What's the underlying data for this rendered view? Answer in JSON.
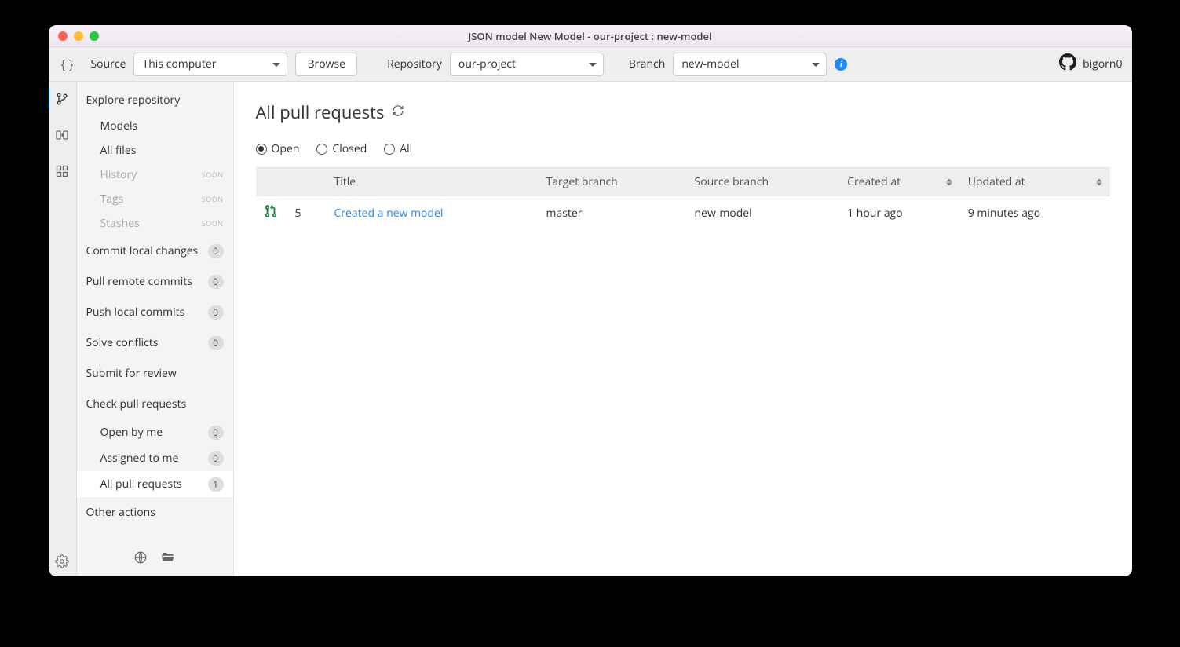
{
  "window": {
    "title": "JSON model New Model - our-project : new-model"
  },
  "toolbar": {
    "source_label": "Source",
    "source_value": "This computer",
    "browse_label": "Browse",
    "repository_label": "Repository",
    "repository_value": "our-project",
    "branch_label": "Branch",
    "branch_value": "new-model",
    "username": "bigorn0"
  },
  "sidebar": {
    "explore_header": "Explore repository",
    "models": "Models",
    "all_files": "All files",
    "history": "History",
    "tags": "Tags",
    "stashes": "Stashes",
    "soon_label": "SOON",
    "commit_local": {
      "label": "Commit local changes",
      "count": "0"
    },
    "pull_remote": {
      "label": "Pull remote commits",
      "count": "0"
    },
    "push_local": {
      "label": "Push local commits",
      "count": "0"
    },
    "solve_conflicts": {
      "label": "Solve conflicts",
      "count": "0"
    },
    "submit_review": "Submit for review",
    "check_prs": "Check pull requests",
    "open_by_me": {
      "label": "Open by me",
      "count": "0"
    },
    "assigned_to_me": {
      "label": "Assigned to me",
      "count": "0"
    },
    "all_prs": {
      "label": "All pull requests",
      "count": "1"
    },
    "other_actions": "Other actions"
  },
  "main": {
    "title": "All pull requests",
    "filters": {
      "open": "Open",
      "closed": "Closed",
      "all": "All"
    },
    "columns": {
      "icon": "",
      "number": "",
      "title": "Title",
      "target": "Target branch",
      "source": "Source branch",
      "created": "Created at",
      "updated": "Updated at"
    },
    "rows": [
      {
        "number": "5",
        "title": "Created a new model",
        "target": "master",
        "source": "new-model",
        "created": "1 hour ago",
        "updated": "9 minutes ago"
      }
    ]
  }
}
